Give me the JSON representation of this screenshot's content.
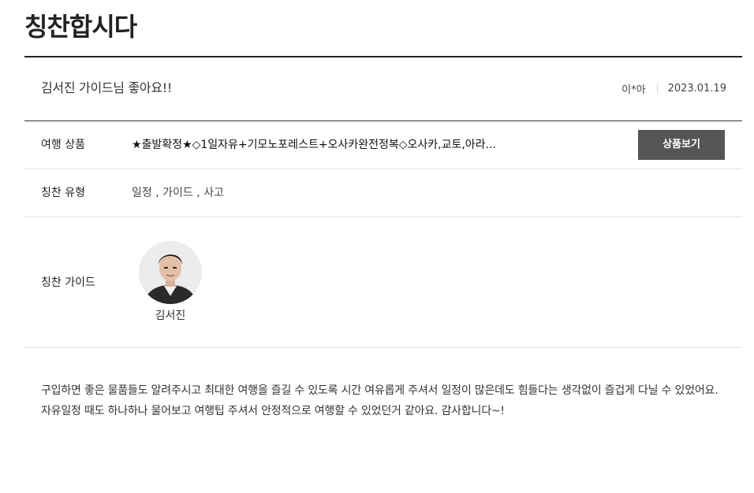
{
  "page": {
    "title": "칭찬합시다"
  },
  "post": {
    "title": "김서진 가이드님 좋아요!!",
    "author": "이*아",
    "date": "2023.01.19"
  },
  "rows": {
    "product": {
      "label": "여행 상품",
      "value": "★출발확정★◇1일자유+기모노포레스트+오사카완전정복◇오사카,교토,아라...",
      "button_label": "상품보기"
    },
    "types": {
      "label": "칭찬 유형",
      "value": "일정 , 가이드 , 사고"
    },
    "guide": {
      "label": "칭찬 가이드",
      "name": "김서진"
    }
  },
  "review": {
    "body": "구입하면 좋은 물품들도 알려주시고 최대한 여행을 즐길 수 있도록 시간 여유롭게 주셔서 일정이 많은데도 힘들다는 생각없이 즐겁게 다닐 수 있었어요. 자유일정 때도 하나하나 물어보고 여행팁 주셔서 안정적으로 여행할 수 있었던거 같아요. 감사합니다~!"
  },
  "colors": {
    "button_bg": "#555555",
    "rule_dark": "#222222",
    "rule_light": "#e2e2e2"
  }
}
